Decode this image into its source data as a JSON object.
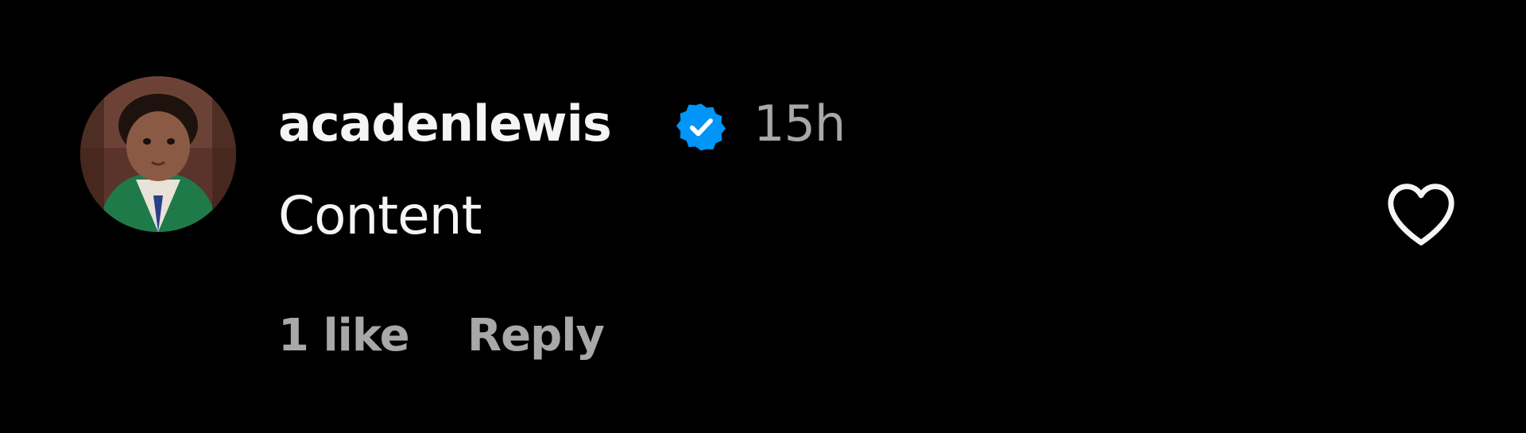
{
  "comment": {
    "username": "acadenlewis",
    "verified": true,
    "timestamp": "15h",
    "text": "Content",
    "likes": "1 like",
    "reply_label": "Reply",
    "liked": false
  },
  "colors": {
    "background": "#000000",
    "primary_text": "#f5f5f5",
    "secondary_text": "#a8a8a8",
    "verified_badge": "#0095f6"
  },
  "icons": {
    "verified": "verified-badge-icon",
    "like": "heart-outline-icon"
  }
}
